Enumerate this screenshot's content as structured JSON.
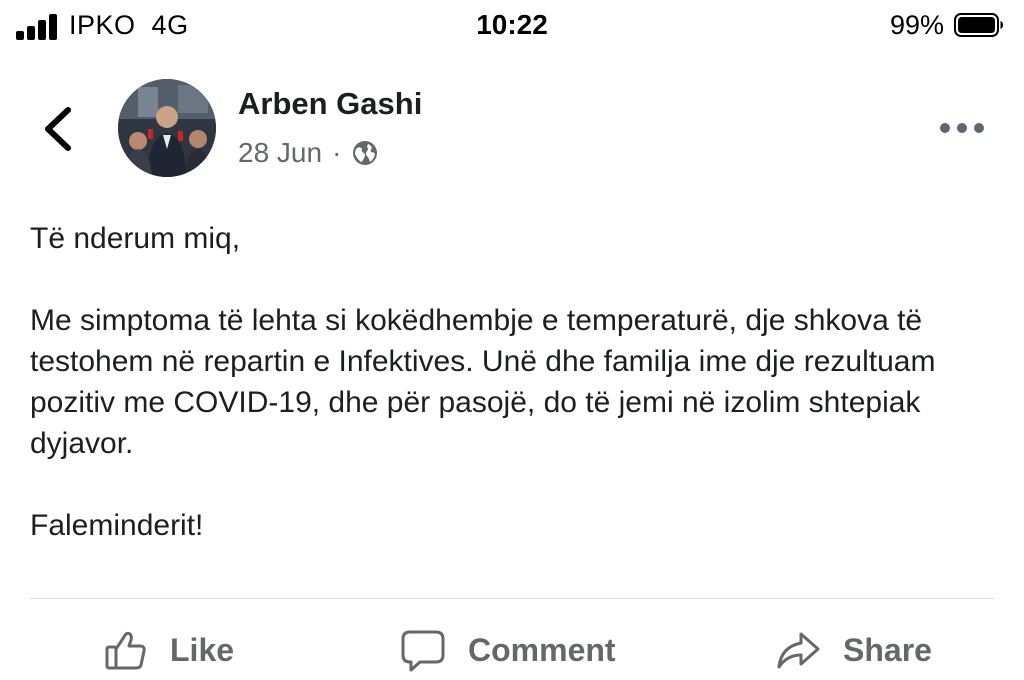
{
  "status_bar": {
    "carrier": "IPKO",
    "network": "4G",
    "time": "10:22",
    "battery_percent": "99%"
  },
  "post": {
    "author": "Arben Gashi",
    "date": "28 Jun",
    "separator": "·",
    "audience_icon": "globe-icon",
    "paragraphs": [
      "Të nderum miq,",
      "Me simptoma të lehta si kokëdhembje e temperaturë, dje shkova të testohem në repartin e Infektives. Unë dhe familja ime dje rezultuam pozitiv me COVID-19, dhe për pasojë, do të jemi në izolim shtepiak dyjavor.",
      "Faleminderit!"
    ]
  },
  "actions": {
    "like": "Like",
    "comment": "Comment",
    "share": "Share"
  },
  "colors": {
    "text": "#1c1e21",
    "secondary": "#65676b",
    "divider": "#dadde1"
  }
}
